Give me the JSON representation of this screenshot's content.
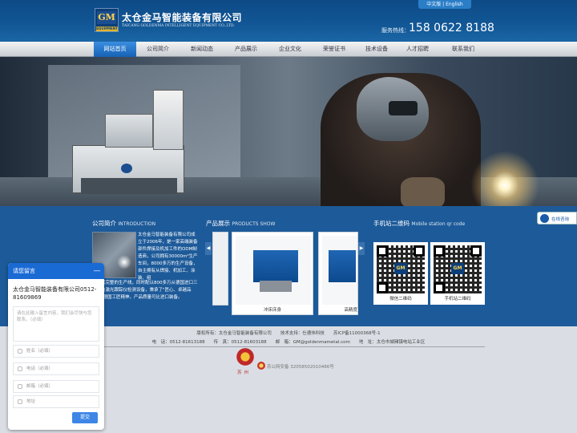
{
  "header": {
    "logo_text": "GM",
    "logo_sub": "EQUIPMENT",
    "company_cn": "太仓金马智能装备有限公司",
    "company_en": "TAICANG GOLDENMA INTELLIGENT EQUIPMENT CO.,LTD.",
    "lang_switch": "中文版 | English",
    "hotline_label": "服务热线：",
    "hotline": "158 0622 8188"
  },
  "nav": {
    "items": [
      {
        "label": "网站首页"
      },
      {
        "label": "公司简介"
      },
      {
        "label": "新闻动态"
      },
      {
        "label": "产品展示"
      },
      {
        "label": "企业文化"
      },
      {
        "label": "荣誉证书"
      },
      {
        "label": "技术设备"
      },
      {
        "label": "人才招聘"
      },
      {
        "label": "联系我们"
      }
    ]
  },
  "intro": {
    "title_cn": "公司简介",
    "title_en": "INTRODUCTION",
    "text_a": "太仓金马智能装备有限公司成立于2006年，是一家高端装备部件焊接及机加工件的ODM制造商，公司拥有30000m²生产车间，8000多万的生产设备，自主拥有从焊接、机加工、涂装、组",
    "text_b": "装测试完整的生产线，同时配以800多万从德国进口三坐标及激光跟踪仪检测设备，秉承了\"匠心、卓越品质\"的德国工匠精神，产品质量可比进口装备。"
  },
  "products": {
    "title_cn": "产品展示",
    "title_en": "PRODUCTS SHOW",
    "items": [
      {
        "caption": "冲床床身"
      },
      {
        "caption": "高精度"
      }
    ]
  },
  "qr": {
    "title_cn": "手机站二维码",
    "title_en": "Mobile station qr code",
    "items": [
      {
        "caption": "微信二维码",
        "logo": "GM"
      },
      {
        "caption": "手机站二维码",
        "logo": "GM"
      }
    ]
  },
  "online": {
    "label": "在线咨询"
  },
  "footer": {
    "line1": "版权所有：太仓金马智能装备有限公司　　技术支持：仕德伟科技　　苏ICP备11000368号-1",
    "line2": "电　话：0512-81613188　　传　真：0512-81603188　　邮　箱：GM@goldenmametal.com　　地　址：太仓市城厢镇电站工业区",
    "city": "苏州",
    "beian": "苏公网安备 32058502010486号"
  },
  "chat": {
    "title": "请您留言",
    "minimize": "—",
    "company": "太仓金马智能装备有限公司0512-81609869",
    "message_placeholder": "请在此输入留言内容，我们会尽快与您联系。（必填）",
    "fields": [
      {
        "placeholder": "姓名（必填）"
      },
      {
        "placeholder": "电话（必填）"
      },
      {
        "placeholder": "邮箱（必填）"
      },
      {
        "placeholder": "地址"
      }
    ],
    "submit": "提交"
  },
  "colors": {
    "header_blue": "#125796",
    "content_blue": "#1d5a99",
    "nav_active": "#1662b5",
    "chat_blue": "#1a6ad4"
  }
}
